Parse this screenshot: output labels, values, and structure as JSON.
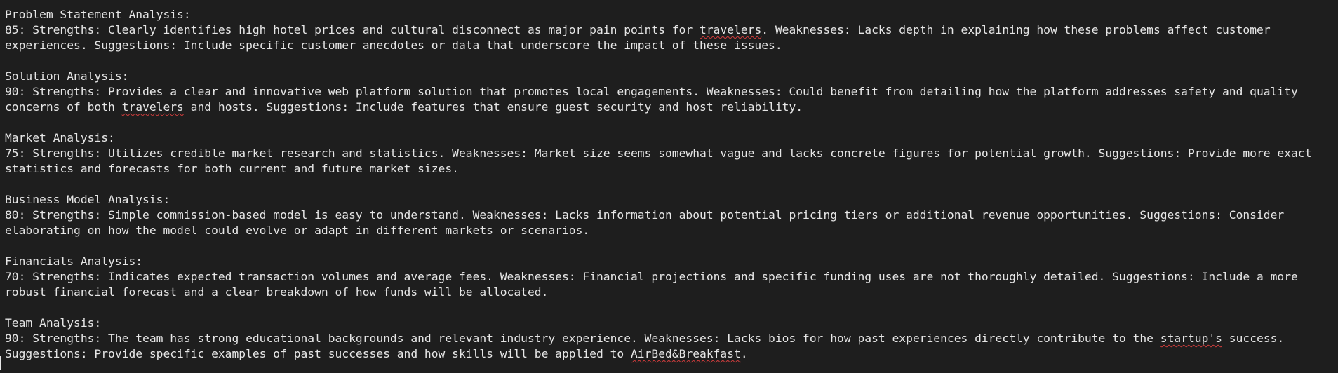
{
  "sections": [
    {
      "heading": "Problem Statement Analysis:",
      "body_parts": [
        {
          "text": "85: Strengths: Clearly identifies high hotel prices and cultural disconnect as major pain points for ",
          "spell": false
        },
        {
          "text": "travelers",
          "spell": true
        },
        {
          "text": ". Weaknesses: Lacks depth in explaining how these problems affect customer experiences. Suggestions: Include specific customer anecdotes or data that underscore the impact of these issues.",
          "spell": false
        }
      ]
    },
    {
      "heading": "Solution Analysis:",
      "body_parts": [
        {
          "text": "90: Strengths: Provides a clear and innovative web platform solution that promotes local engagements. Weaknesses: Could benefit from detailing how the platform addresses safety and quality concerns of both ",
          "spell": false
        },
        {
          "text": "travelers",
          "spell": true
        },
        {
          "text": " and hosts. Suggestions: Include features that ensure guest security and host reliability.",
          "spell": false
        }
      ]
    },
    {
      "heading": "Market Analysis:",
      "body_parts": [
        {
          "text": "75: Strengths: Utilizes credible market research and statistics. Weaknesses: Market size seems somewhat vague and lacks concrete figures for potential growth. Suggestions: Provide more exact statistics and forecasts for both current and future market sizes.",
          "spell": false
        }
      ]
    },
    {
      "heading": "Business Model Analysis:",
      "body_parts": [
        {
          "text": "80: Strengths: Simple commission-based model is easy to understand. Weaknesses: Lacks information about potential pricing tiers or additional revenue opportunities. Suggestions: Consider elaborating on how the model could evolve or adapt in different markets or scenarios.",
          "spell": false
        }
      ]
    },
    {
      "heading": "Financials Analysis:",
      "body_parts": [
        {
          "text": "70: Strengths: Indicates expected transaction volumes and average fees. Weaknesses: Financial projections and specific funding uses are not thoroughly detailed. Suggestions: Include a more robust financial forecast and a clear breakdown of how funds will be allocated.",
          "spell": false
        }
      ]
    },
    {
      "heading": "Team Analysis:",
      "body_parts": [
        {
          "text": "90: Strengths: The team has strong educational backgrounds and relevant industry experience. Weaknesses: Lacks bios for how past experiences directly contribute to the ",
          "spell": false
        },
        {
          "text": "startup's",
          "spell": true
        },
        {
          "text": " success. Suggestions: Provide specific examples of past successes and how skills will be applied to ",
          "spell": false
        },
        {
          "text": "AirBed&Breakfast",
          "spell": true
        },
        {
          "text": ".",
          "spell": false
        }
      ]
    }
  ],
  "colors": {
    "background": "#1e1e1e",
    "text": "#e6e6e6",
    "spellcheck_underline": "#d13c3c"
  }
}
